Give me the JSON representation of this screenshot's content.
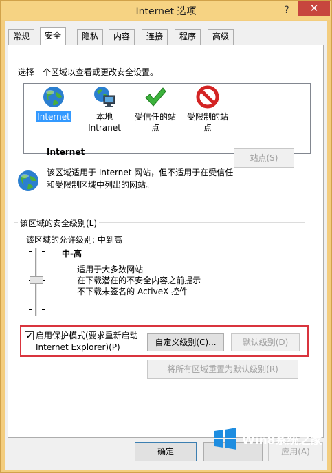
{
  "window": {
    "title": "Internet 选项",
    "help_label": "?",
    "close_label": "✕"
  },
  "tabs": [
    {
      "label": "常规"
    },
    {
      "label": "安全"
    },
    {
      "label": "隐私"
    },
    {
      "label": "内容"
    },
    {
      "label": "连接"
    },
    {
      "label": "程序"
    },
    {
      "label": "高级"
    }
  ],
  "zones": {
    "prompt": "选择一个区域以查看或更改安全设置。",
    "items": [
      {
        "line1": "Internet",
        "line2": "",
        "icon": "globe-icon",
        "selected": true
      },
      {
        "line1": "本地",
        "line2": "Intranet",
        "icon": "local-intranet-icon",
        "selected": false
      },
      {
        "line1": "受信任的站",
        "line2": "点",
        "icon": "check-icon",
        "selected": false
      },
      {
        "line1": "受限制的站",
        "line2": "点",
        "icon": "restricted-icon",
        "selected": false
      }
    ]
  },
  "info": {
    "title": "Internet",
    "description": "该区域适用于 Internet 网站，但不适用于在受信任和受限制区域中列出的网站。",
    "sites_button": "站点(S)"
  },
  "security_level": {
    "group_title": "该区域的安全级别(L)",
    "allowed": "该区域的允许级别: 中到高",
    "level_name": "中-高",
    "bullets": [
      "- 适用于大多数网站",
      "- 在下载潜在的不安全内容之前提示",
      "- 不下载未签名的 ActiveX 控件"
    ],
    "protected_mode_line1": "启用保护模式(要求重新启动",
    "protected_mode_line2": "Internet Explorer)(P)",
    "protected_mode_checked": true,
    "checkbox_mark": "✔",
    "custom_level_button": "自定义级别(C)...",
    "default_level_button": "默认级别(D)",
    "reset_all_button": "将所有区域重置为默认级别(R)"
  },
  "footer": {
    "ok_button": "确定",
    "cancel_button": "",
    "apply_button": "应用(A)"
  },
  "watermark": {
    "text": "Win8系统之家"
  },
  "colors": {
    "selection": "#3399ff",
    "highlight_border": "#d9343d",
    "close_button": "#c7463e",
    "title_bar": "#f6d383"
  }
}
